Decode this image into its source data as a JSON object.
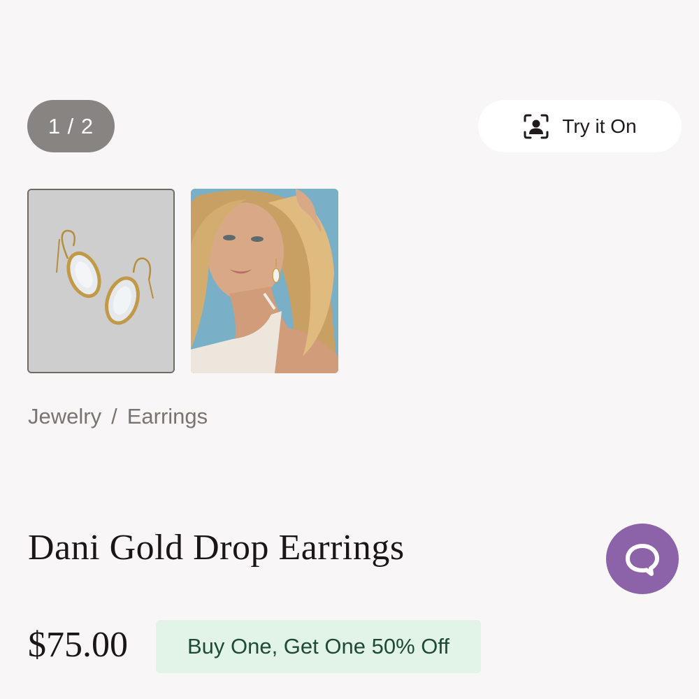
{
  "gallery": {
    "counter": "1 / 2",
    "thumbnails": [
      {
        "name": "earrings-product-image"
      },
      {
        "name": "model-wearing-earrings-image"
      }
    ]
  },
  "try_on": {
    "label": "Try it On",
    "icon": "face-scan-icon"
  },
  "breadcrumb": {
    "items": [
      "Jewelry",
      "Earrings"
    ],
    "separator": "/"
  },
  "product": {
    "title": "Dani Gold Drop Earrings",
    "price": "$75.00",
    "promo": "Buy One, Get One 50% Off"
  },
  "chat": {
    "icon": "chat-bubble-icon"
  },
  "colors": {
    "background": "#f8f6f7",
    "counter_bg": "#878482",
    "chat_button": "#8c62a8",
    "promo_bg": "#e2f3e8",
    "promo_text": "#1f4a34"
  }
}
